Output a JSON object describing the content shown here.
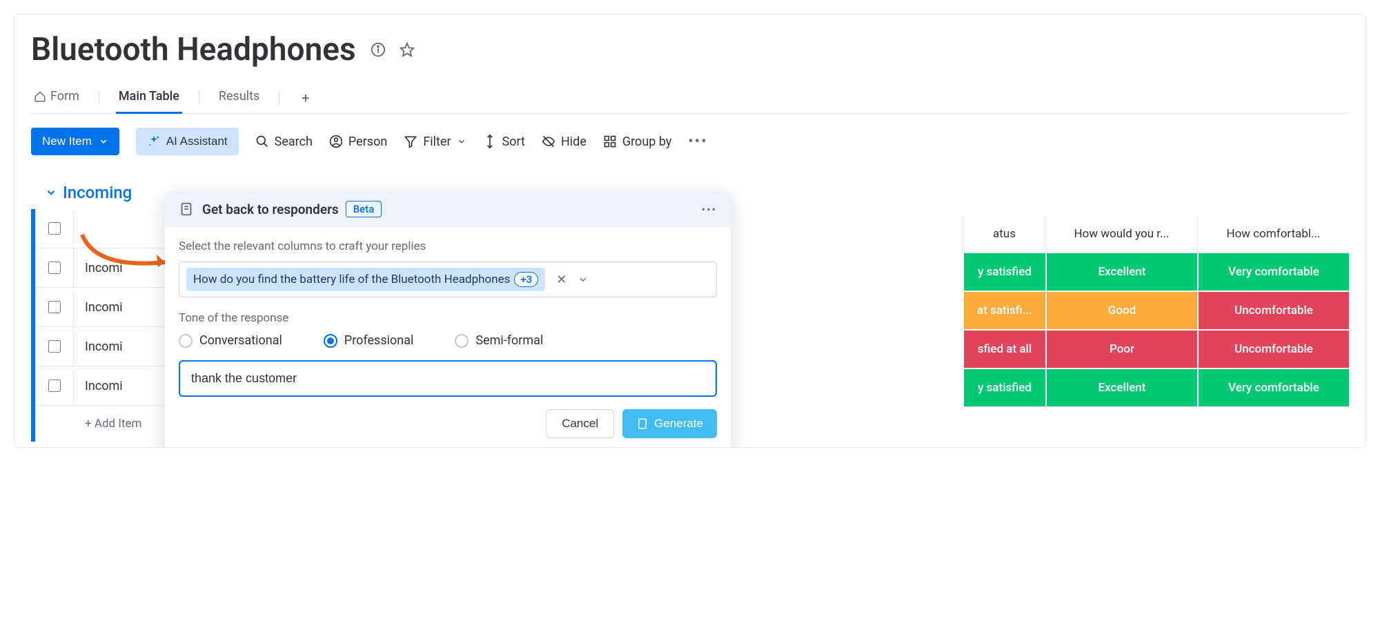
{
  "header": {
    "title": "Bluetooth Headphones"
  },
  "tabs": {
    "form": "Form",
    "main_table": "Main Table",
    "results": "Results"
  },
  "toolbar": {
    "new_item": "New Item",
    "ai_assistant": "AI Assistant",
    "search": "Search",
    "person": "Person",
    "filter": "Filter",
    "sort": "Sort",
    "hide": "Hide",
    "group_by": "Group by"
  },
  "group": {
    "name": "Incoming"
  },
  "rows": [
    {
      "name": "Incomi"
    },
    {
      "name": "Incomi"
    },
    {
      "name": "Incomi"
    },
    {
      "name": "Incomi"
    }
  ],
  "add_item": "+ Add Item",
  "columns": {
    "c0": "atus",
    "c1": "How would you r...",
    "c2": "How comfortabl..."
  },
  "cells": [
    {
      "c0": {
        "text": "y satisfied",
        "color": "#00c875"
      },
      "c1": {
        "text": "Excellent",
        "color": "#00c875"
      },
      "c2": {
        "text": "Very comfortable",
        "color": "#00c875"
      }
    },
    {
      "c0": {
        "text": "at satisfi...",
        "color": "#fdab3d"
      },
      "c1": {
        "text": "Good",
        "color": "#fdab3d"
      },
      "c2": {
        "text": "Uncomfortable",
        "color": "#e2445c"
      }
    },
    {
      "c0": {
        "text": "sfied at all",
        "color": "#e2445c"
      },
      "c1": {
        "text": "Poor",
        "color": "#e2445c"
      },
      "c2": {
        "text": "Uncomfortable",
        "color": "#e2445c"
      }
    },
    {
      "c0": {
        "text": "y satisfied",
        "color": "#00c875"
      },
      "c1": {
        "text": "Excellent",
        "color": "#00c875"
      },
      "c2": {
        "text": "Very comfortable",
        "color": "#00c875"
      }
    }
  ],
  "popup": {
    "title": "Get back to responders",
    "beta": "Beta",
    "select_label": "Select the relevant columns to craft your replies",
    "chip_text": "How do you find the battery life of the Bluetooth Headphones",
    "chip_count": "+3",
    "tone_label": "Tone of the response",
    "tones": {
      "conversational": "Conversational",
      "professional": "Professional",
      "semi_formal": "Semi-formal"
    },
    "selected_tone": "professional",
    "prompt_value": "thank the customer",
    "cancel": "Cancel",
    "generate": "Generate"
  }
}
